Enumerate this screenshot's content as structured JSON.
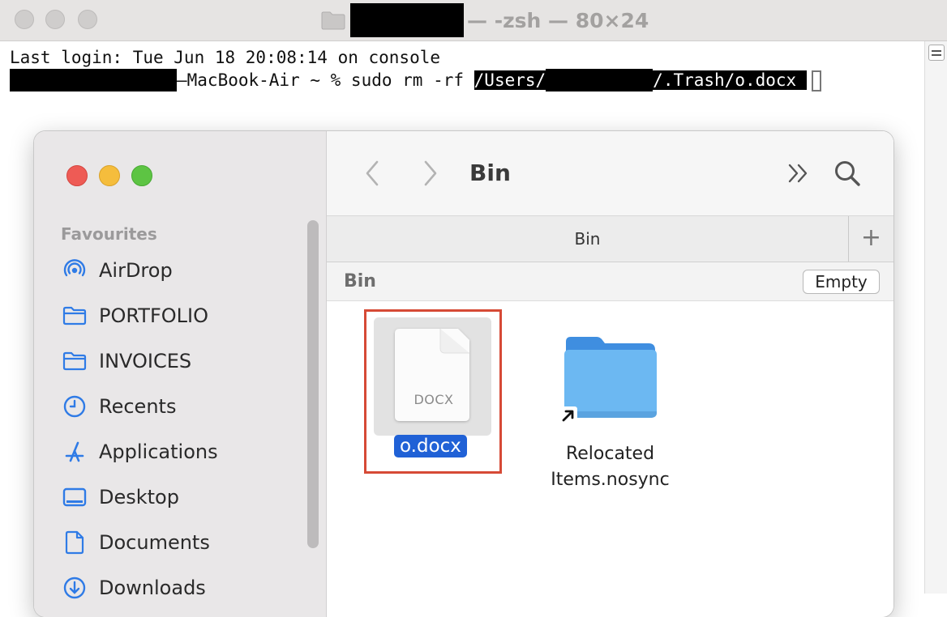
{
  "terminal": {
    "title_suffix": "— -zsh — 80×24",
    "line1": "Last login: Tue Jun 18 20:08:14 on console",
    "prompt_host": "—MacBook-Air ~ % sudo rm -rf ",
    "path_start": "/Users/",
    "path_end": "/.Trash/o.docx "
  },
  "finder": {
    "sidebar": {
      "section": "Favourites",
      "items": [
        {
          "label": "AirDrop",
          "icon": "airdrop-icon"
        },
        {
          "label": "PORTFOLIO",
          "icon": "folder-icon"
        },
        {
          "label": "INVOICES",
          "icon": "folder-icon"
        },
        {
          "label": "Recents",
          "icon": "clock-icon"
        },
        {
          "label": "Applications",
          "icon": "applications-icon"
        },
        {
          "label": "Desktop",
          "icon": "desktop-icon"
        },
        {
          "label": "Documents",
          "icon": "document-icon"
        },
        {
          "label": "Downloads",
          "icon": "download-icon"
        }
      ]
    },
    "toolbar": {
      "title": "Bin"
    },
    "tab": {
      "label": "Bin",
      "add": "+"
    },
    "pathbar": {
      "title": "Bin",
      "empty_label": "Empty"
    },
    "files": [
      {
        "name": "o.docx",
        "type_label": "DOCX",
        "selected": true
      },
      {
        "name_line1": "Relocated",
        "name_line2": "Items.nosync"
      }
    ]
  },
  "colors": {
    "accent": "#2061d6",
    "highlight": "#d64a36",
    "folder": "#5ba8e8"
  }
}
